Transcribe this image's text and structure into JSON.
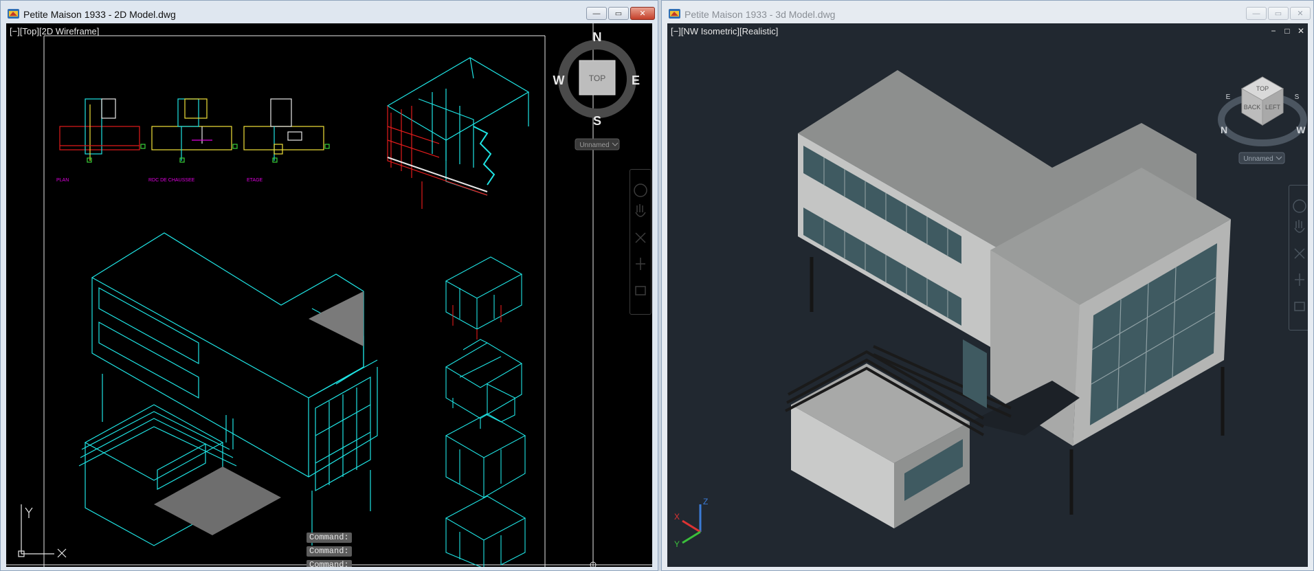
{
  "windows": {
    "left": {
      "title": "Petite Maison 1933 - 2D Model.dwg",
      "viewport_label": "[−][Top][2D Wireframe]",
      "viewcube": {
        "face": "TOP",
        "north": "N",
        "south": "S",
        "east": "E",
        "west": "W",
        "ucs_menu": "Unnamed"
      },
      "ucs": {
        "x": "X",
        "y": "Y"
      },
      "command_lines": [
        "Command:",
        "Command:",
        "Command:"
      ],
      "floor_plan_labels": [
        "PLAN",
        "RDC DE CHAUSSEE",
        "ETAGE"
      ],
      "accent_color": "#1fe4e4",
      "section_color": "#e21b1b",
      "text_color": "#e000e0"
    },
    "right": {
      "title": "Petite Maison 1933 - 3d Model.dwg",
      "viewport_label": "[−][NW Isometric][Realistic]",
      "viewcube": {
        "top": "TOP",
        "back": "BACK",
        "left": "LEFT",
        "n": "N",
        "w": "W",
        "e": "E",
        "s": "S",
        "ucs_menu": "Unnamed"
      },
      "ucs": {
        "x": "X",
        "y": "Y",
        "z": "Z"
      },
      "viewport_controls": [
        "−",
        "□",
        "✕"
      ]
    }
  },
  "window_controls": {
    "minimize": "—",
    "restore": "▭",
    "close": "✕"
  }
}
